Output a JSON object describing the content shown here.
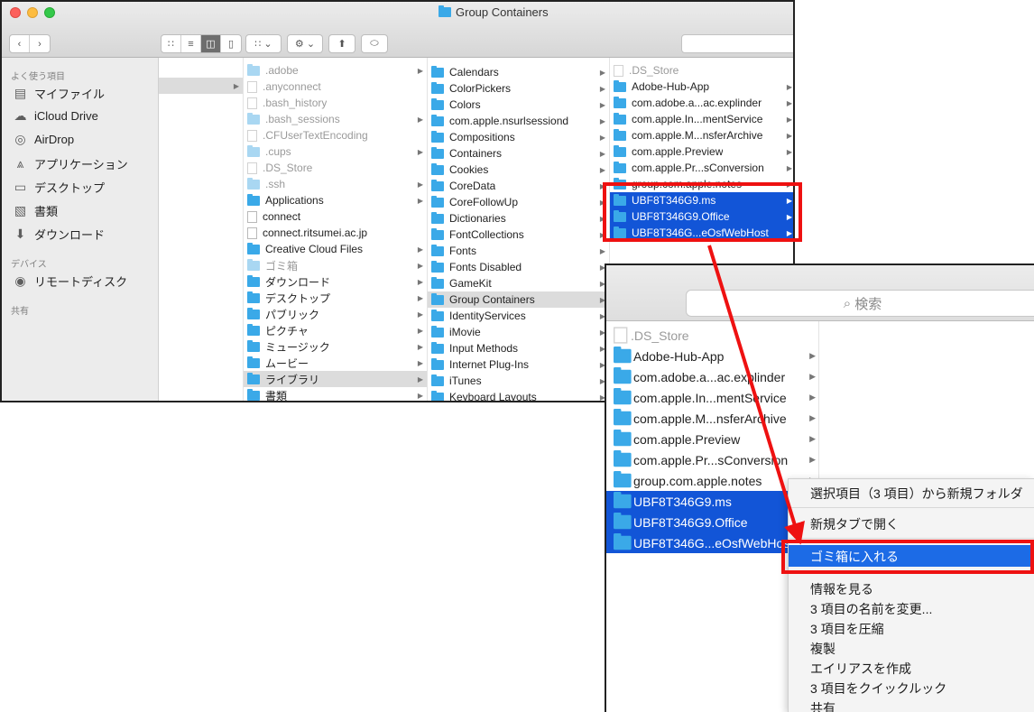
{
  "window": {
    "title": "Group Containers"
  },
  "sidebar": {
    "favorites_header": "よく使う項目",
    "favorites": [
      {
        "label": "マイファイル",
        "icon": "all-my-files-icon"
      },
      {
        "label": "iCloud Drive",
        "icon": "cloud-icon"
      },
      {
        "label": "AirDrop",
        "icon": "airdrop-icon"
      },
      {
        "label": "アプリケーション",
        "icon": "applications-icon"
      },
      {
        "label": "デスクトップ",
        "icon": "desktop-icon"
      },
      {
        "label": "書類",
        "icon": "documents-icon"
      },
      {
        "label": "ダウンロード",
        "icon": "downloads-icon"
      }
    ],
    "devices_header": "デバイス",
    "devices": [
      {
        "label": "リモートディスク",
        "icon": "disc-icon"
      }
    ],
    "shared_header": "共有"
  },
  "columns": {
    "home": [
      {
        "label": ".adobe",
        "kind": "folder-dim",
        "arrow": true
      },
      {
        "label": ".anyconnect",
        "kind": "file-dim",
        "arrow": false
      },
      {
        "label": ".bash_history",
        "kind": "file-dim",
        "arrow": false
      },
      {
        "label": ".bash_sessions",
        "kind": "folder-dim",
        "arrow": true
      },
      {
        "label": ".CFUserTextEncoding",
        "kind": "file-dim",
        "arrow": false
      },
      {
        "label": ".cups",
        "kind": "folder-dim",
        "arrow": true
      },
      {
        "label": ".DS_Store",
        "kind": "file-dim",
        "arrow": false
      },
      {
        "label": ".ssh",
        "kind": "folder-dim",
        "arrow": true
      },
      {
        "label": "Applications",
        "kind": "folder",
        "arrow": true
      },
      {
        "label": "connect",
        "kind": "file",
        "arrow": false
      },
      {
        "label": "connect.ritsumei.ac.jp",
        "kind": "file",
        "arrow": false
      },
      {
        "label": "Creative Cloud Files",
        "kind": "folder",
        "arrow": true
      },
      {
        "label": "ゴミ箱",
        "kind": "folder-dim",
        "arrow": true
      },
      {
        "label": "ダウンロード",
        "kind": "folder",
        "arrow": true
      },
      {
        "label": "デスクトップ",
        "kind": "folder",
        "arrow": true
      },
      {
        "label": "パブリック",
        "kind": "folder",
        "arrow": true
      },
      {
        "label": "ピクチャ",
        "kind": "folder",
        "arrow": true
      },
      {
        "label": "ミュージック",
        "kind": "folder",
        "arrow": true
      },
      {
        "label": "ムービー",
        "kind": "folder",
        "arrow": true
      },
      {
        "label": "ライブラリ",
        "kind": "folder",
        "arrow": true
      },
      {
        "label": "書類",
        "kind": "folder",
        "arrow": true
      }
    ],
    "library": [
      "Calendars",
      "ColorPickers",
      "Colors",
      "com.apple.nsurlsessiond",
      "Compositions",
      "Containers",
      "Cookies",
      "CoreData",
      "CoreFollowUp",
      "Dictionaries",
      "FontCollections",
      "Fonts",
      "Fonts Disabled",
      "GameKit",
      "Group Containers",
      "IdentityServices",
      "iMovie",
      "Input Methods",
      "Internet Plug-Ins",
      "iTunes",
      "Keyboard Layouts"
    ],
    "group_containers": [
      {
        "label": ".DS_Store",
        "kind": "file-dim",
        "arrow": false
      },
      {
        "label": "Adobe-Hub-App",
        "kind": "folder",
        "arrow": true
      },
      {
        "label": "com.adobe.a...ac.explinder",
        "kind": "folder",
        "arrow": true
      },
      {
        "label": "com.apple.In...mentService",
        "kind": "folder",
        "arrow": true
      },
      {
        "label": "com.apple.M...nsferArchive",
        "kind": "folder",
        "arrow": true
      },
      {
        "label": "com.apple.Preview",
        "kind": "folder",
        "arrow": true
      },
      {
        "label": "com.apple.Pr...sConversion",
        "kind": "folder",
        "arrow": true
      },
      {
        "label": "group.com.apple.notes",
        "kind": "folder",
        "arrow": true
      },
      {
        "label": "UBF8T346G9.ms",
        "kind": "folder",
        "arrow": true
      },
      {
        "label": "UBF8T346G9.Office",
        "kind": "folder",
        "arrow": true
      },
      {
        "label": "UBF8T346G...eOsfWebHost",
        "kind": "folder",
        "arrow": true
      }
    ]
  },
  "inset": {
    "search_placeholder": "検索",
    "items": [
      {
        "label": ".DS_Store",
        "kind": "file-dim",
        "arrow": false
      },
      {
        "label": "Adobe-Hub-App",
        "kind": "folder",
        "arrow": true
      },
      {
        "label": "com.adobe.a...ac.explinder",
        "kind": "folder",
        "arrow": true
      },
      {
        "label": "com.apple.In...mentService",
        "kind": "folder",
        "arrow": true
      },
      {
        "label": "com.apple.M...nsferArchive",
        "kind": "folder",
        "arrow": true
      },
      {
        "label": "com.apple.Preview",
        "kind": "folder",
        "arrow": true
      },
      {
        "label": "com.apple.Pr...sConversion",
        "kind": "folder",
        "arrow": true
      },
      {
        "label": "group.com.apple.notes",
        "kind": "folder",
        "arrow": true
      },
      {
        "label": "UBF8T346G9.ms",
        "kind": "folder",
        "arrow": true
      },
      {
        "label": "UBF8T346G9.Office",
        "kind": "folder",
        "arrow": true
      },
      {
        "label": "UBF8T346G...eOsfWebHost",
        "kind": "folder",
        "arrow": true
      }
    ]
  },
  "context_menu": {
    "new_folder_from_selection": "選択項目（3 項目）から新規フォルダ",
    "open_in_new_tab": "新規タブで開く",
    "move_to_trash": "ゴミ箱に入れる",
    "get_info": "情報を見る",
    "rename": "3 項目の名前を変更...",
    "compress": "3 項目を圧縮",
    "duplicate": "複製",
    "make_alias": "エイリアスを作成",
    "quick_look": "3 項目をクイックルック",
    "share": "共有"
  },
  "colors": {
    "selection": "#1255d7",
    "highlight_box": "#ee1111",
    "folder": "#3aa9e8"
  }
}
